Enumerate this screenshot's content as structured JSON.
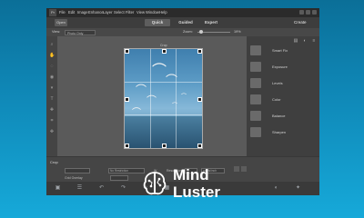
{
  "menu": {
    "logo": "Pr",
    "open_label": "Open",
    "items": [
      "File",
      "Edit",
      "Image",
      "Enhance",
      "Layer",
      "Select",
      "Filter",
      "View",
      "Window",
      "Help"
    ]
  },
  "modes": {
    "quick": "Quick",
    "guided": "Guided",
    "expert": "Expert"
  },
  "create_label": "Create",
  "options_bar": {
    "view_label": "View:",
    "view_value": "Photo Only",
    "zoom_label": "Zoom:",
    "zoom_value": "19%"
  },
  "canvas": {
    "document_label": "Crop"
  },
  "right_panel": {
    "items": [
      {
        "label": "Smart Fix",
        "icon": "smart-fix-icon"
      },
      {
        "label": "Exposure",
        "icon": "exposure-icon"
      },
      {
        "label": "Levels",
        "icon": "levels-icon"
      },
      {
        "label": "Color",
        "icon": "color-icon"
      },
      {
        "label": "Balance",
        "icon": "balance-icon"
      },
      {
        "label": "Sharpen",
        "icon": "sharpen-icon"
      }
    ]
  },
  "bottom_options": {
    "title": "Crop",
    "preset_value": "No Restriction",
    "width_label": "W",
    "height_label": "H",
    "resolution_label": "Resolution:",
    "resolution_unit": "pixels/inch",
    "grid_label": "Grid Overlay"
  },
  "watermark": {
    "line1": "Mind",
    "line2": "Luster"
  },
  "colors": {
    "accent": "#ffffff",
    "background_top": "#0b6f98",
    "background_bottom": "#16a9d9",
    "app_bg": "#4d4d4d"
  }
}
